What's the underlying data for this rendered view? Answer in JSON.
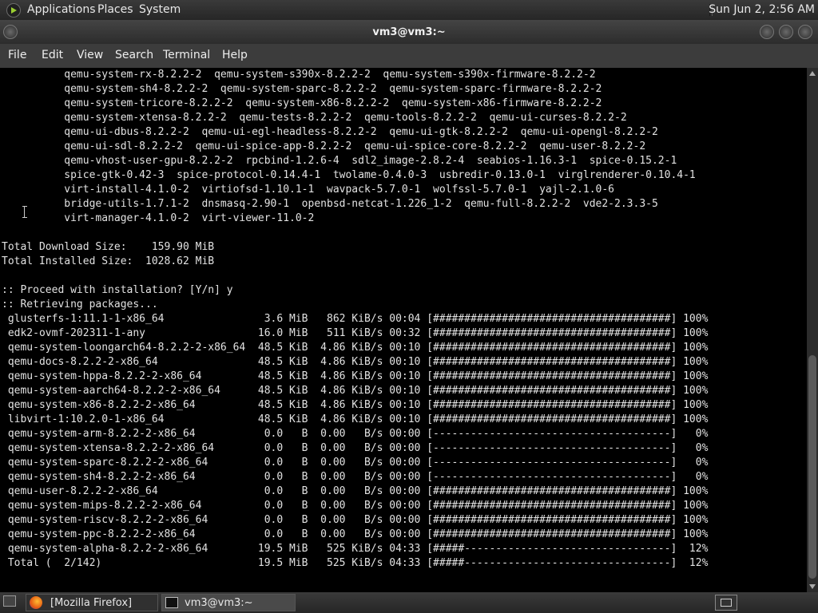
{
  "top_panel": {
    "menus": [
      "Applications",
      "Places",
      "System"
    ],
    "clock": "Sun Jun  2,  2:56 AM"
  },
  "window": {
    "title": "vm3@vm3:~",
    "menu": [
      "File",
      "Edit",
      "View",
      "Search",
      "Terminal",
      "Help"
    ]
  },
  "terminal": {
    "lines": [
      "          qemu-system-rx-8.2.2-2  qemu-system-s390x-8.2.2-2  qemu-system-s390x-firmware-8.2.2-2",
      "          qemu-system-sh4-8.2.2-2  qemu-system-sparc-8.2.2-2  qemu-system-sparc-firmware-8.2.2-2",
      "          qemu-system-tricore-8.2.2-2  qemu-system-x86-8.2.2-2  qemu-system-x86-firmware-8.2.2-2",
      "          qemu-system-xtensa-8.2.2-2  qemu-tests-8.2.2-2  qemu-tools-8.2.2-2  qemu-ui-curses-8.2.2-2",
      "          qemu-ui-dbus-8.2.2-2  qemu-ui-egl-headless-8.2.2-2  qemu-ui-gtk-8.2.2-2  qemu-ui-opengl-8.2.2-2",
      "          qemu-ui-sdl-8.2.2-2  qemu-ui-spice-app-8.2.2-2  qemu-ui-spice-core-8.2.2-2  qemu-user-8.2.2-2",
      "          qemu-vhost-user-gpu-8.2.2-2  rpcbind-1.2.6-4  sdl2_image-2.8.2-4  seabios-1.16.3-1  spice-0.15.2-1",
      "          spice-gtk-0.42-3  spice-protocol-0.14.4-1  twolame-0.4.0-3  usbredir-0.13.0-1  virglrenderer-0.10.4-1",
      "          virt-install-4.1.0-2  virtiofsd-1.10.1-1  wavpack-5.7.0-1  wolfssl-5.7.0-1  yajl-2.1.0-6",
      "          bridge-utils-1.7.1-2  dnsmasq-2.90-1  openbsd-netcat-1.226_1-2  qemu-full-8.2.2-2  vde2-2.3.3-5",
      "          virt-manager-4.1.0-2  virt-viewer-11.0-2",
      "",
      "Total Download Size:    159.90 MiB",
      "Total Installed Size:  1028.62 MiB",
      "",
      ":: Proceed with installation? [Y/n] y",
      ":: Retrieving packages...",
      " glusterfs-1:11.1-1-x86_64                3.6 MiB   862 KiB/s 00:04 [######################################] 100%",
      " edk2-ovmf-202311-1-any                  16.0 MiB   511 KiB/s 00:32 [######################################] 100%",
      " qemu-system-loongarch64-8.2.2-2-x86_64  48.5 KiB  4.86 KiB/s 00:10 [######################################] 100%",
      " qemu-docs-8.2.2-2-x86_64                48.5 KiB  4.86 KiB/s 00:10 [######################################] 100%",
      " qemu-system-hppa-8.2.2-2-x86_64         48.5 KiB  4.86 KiB/s 00:10 [######################################] 100%",
      " qemu-system-aarch64-8.2.2-2-x86_64      48.5 KiB  4.86 KiB/s 00:10 [######################################] 100%",
      " qemu-system-x86-8.2.2-2-x86_64          48.5 KiB  4.86 KiB/s 00:10 [######################################] 100%",
      " libvirt-1:10.2.0-1-x86_64               48.5 KiB  4.86 KiB/s 00:10 [######################################] 100%",
      " qemu-system-arm-8.2.2-2-x86_64           0.0   B  0.00   B/s 00:00 [--------------------------------------]   0%",
      " qemu-system-xtensa-8.2.2-2-x86_64        0.0   B  0.00   B/s 00:00 [--------------------------------------]   0%",
      " qemu-system-sparc-8.2.2-2-x86_64         0.0   B  0.00   B/s 00:00 [--------------------------------------]   0%",
      " qemu-system-sh4-8.2.2-2-x86_64           0.0   B  0.00   B/s 00:00 [--------------------------------------]   0%",
      " qemu-user-8.2.2-2-x86_64                 0.0   B  0.00   B/s 00:00 [######################################] 100%",
      " qemu-system-mips-8.2.2-2-x86_64          0.0   B  0.00   B/s 00:00 [######################################] 100%",
      " qemu-system-riscv-8.2.2-2-x86_64         0.0   B  0.00   B/s 00:00 [######################################] 100%",
      " qemu-system-ppc-8.2.2-2-x86_64           0.0   B  0.00   B/s 00:00 [######################################] 100%",
      " qemu-system-alpha-8.2.2-2-x86_64        19.5 MiB   525 KiB/s 04:33 [#####---------------------------------]  12%",
      " Total (  2/142)                         19.5 MiB   525 KiB/s 04:33 [#####---------------------------------]  12%"
    ]
  },
  "taskbar": {
    "tasks": [
      "[Mozilla Firefox]",
      "vm3@vm3:~"
    ]
  }
}
